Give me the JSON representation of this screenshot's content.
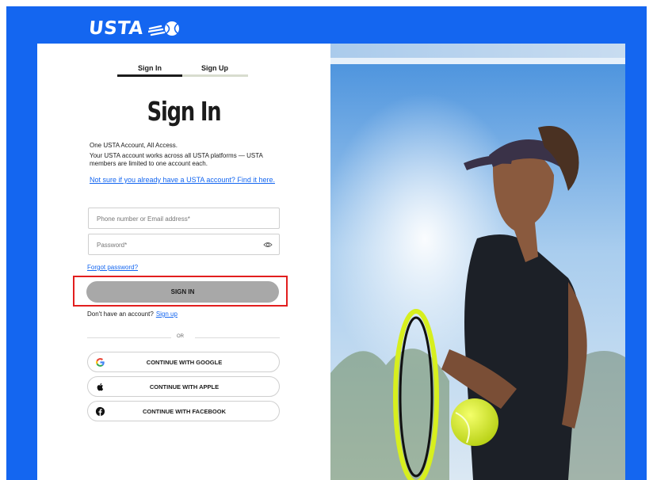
{
  "brand": {
    "logo_text": "USTA",
    "logo_mark": "tennis-ball-swoosh-icon",
    "primary_color": "#1466f0",
    "highlight_color": "#e21e1e"
  },
  "tabs": [
    {
      "label": "Sign In",
      "active": true
    },
    {
      "label": "Sign Up",
      "active": false
    }
  ],
  "heading": "Sign In",
  "intro": {
    "line1": "One USTA Account, All Access.",
    "line2": "Your USTA account works across all USTA platforms — USTA members are limited to one account each."
  },
  "find_account_link": "Not sure if you already have a USTA account? Find it here.",
  "form": {
    "email_placeholder": "Phone number or Email address*",
    "password_placeholder": "Password*",
    "forgot_password": "Forgot password?",
    "sign_in_button": "SIGN IN"
  },
  "signup_prompt": {
    "text": "Don't have an account?",
    "link": "Sign up"
  },
  "divider_text": "OR",
  "social_buttons": [
    {
      "label": "CONTINUE WITH GOOGLE",
      "icon": "google-icon"
    },
    {
      "label": "CONTINUE WITH APPLE",
      "icon": "apple-icon"
    },
    {
      "label": "CONTINUE WITH FACEBOOK",
      "icon": "facebook-icon"
    }
  ],
  "hero_image": "tennis-player-photo"
}
